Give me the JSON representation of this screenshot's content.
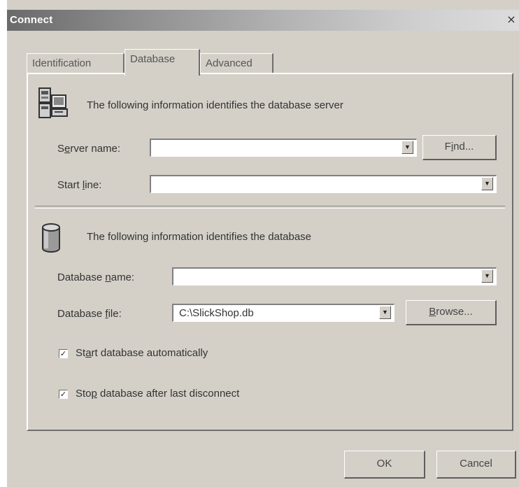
{
  "window": {
    "title": "Connect",
    "close_glyph": "×"
  },
  "tabs": [
    {
      "label": "Identification",
      "selected": false
    },
    {
      "label": "Database",
      "selected": true
    },
    {
      "label": "Advanced",
      "selected": false
    }
  ],
  "server_section": {
    "icon": "server-computer-icon",
    "heading": "The following information identifies the database server",
    "server_name": {
      "label_pre": "S",
      "label_ul": "e",
      "label_post": "rver name:",
      "value": ""
    },
    "find_button": {
      "label_pre": "F",
      "label_ul": "i",
      "label_post": "nd..."
    },
    "start_line": {
      "label_pre": "Start ",
      "label_ul": "l",
      "label_post": "ine:",
      "value": ""
    }
  },
  "database_section": {
    "icon": "database-cylinder-icon",
    "heading": "The following information identifies the database",
    "database_name": {
      "label_pre": "Database ",
      "label_ul": "n",
      "label_post": "ame:",
      "value": ""
    },
    "database_file": {
      "label_pre": "Database ",
      "label_ul": "f",
      "label_post": "ile:",
      "value": "C:\\SlickShop.db"
    },
    "browse_button": {
      "label_pre": "",
      "label_ul": "B",
      "label_post": "rowse..."
    },
    "start_auto": {
      "label_pre": "St",
      "label_ul": "a",
      "label_post": "rt database automatically",
      "checked": true
    },
    "stop_after": {
      "label_pre": "Sto",
      "label_ul": "p",
      "label_post": " database after last disconnect",
      "checked": true
    }
  },
  "footer": {
    "ok_label": "OK",
    "cancel_label": "Cancel"
  },
  "check_glyph": "✓",
  "dropdown_glyph": "▼"
}
